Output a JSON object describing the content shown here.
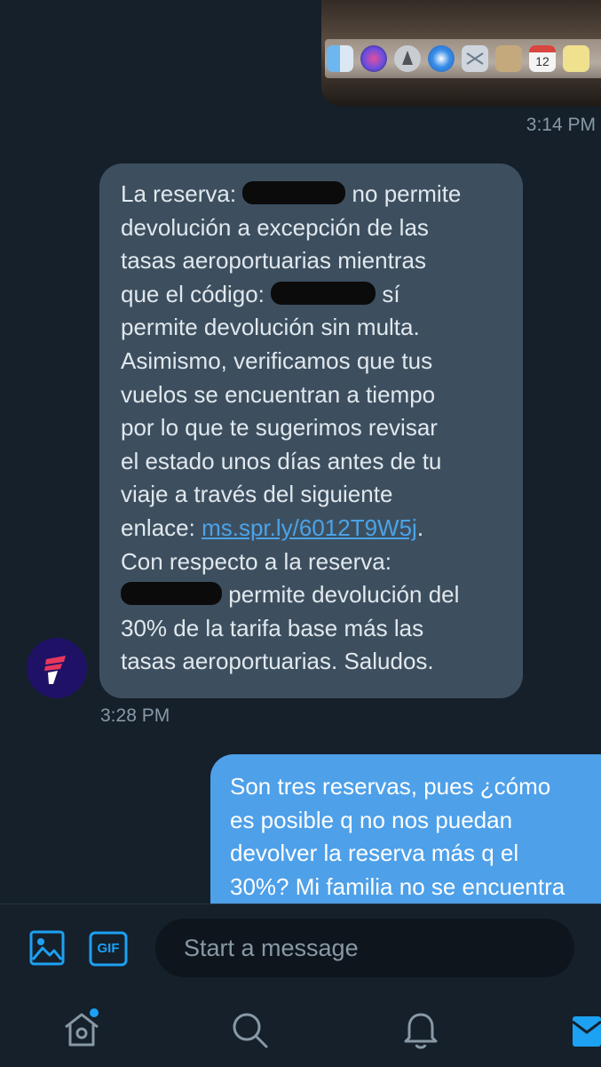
{
  "thread": {
    "image_message": {
      "timestamp": "3:14 PM",
      "calendar_day": "12"
    },
    "incoming_message": {
      "lines": {
        "l1a": "La reserva:",
        "l1b": "no permite",
        "l2": "devolución a excepción de las",
        "l3": "tasas aeroportuarias mientras",
        "l4a": "que el código:",
        "l4b": "sí",
        "l5": "permite devolución sin multa.",
        "l6": "Asimismo, verificamos que tus",
        "l7": "vuelos se encuentran a tiempo",
        "l8": "por lo que te sugerimos revisar",
        "l9": "el estado unos días antes de tu",
        "l10": "viaje a través del siguiente",
        "l11a": "enlace:",
        "l11_link": "ms.spr.ly/6012T9W5j",
        "l11b": ".",
        "l12": "Con respecto a la reserva:",
        "l13b": "permite devolución del",
        "l14": "30% de la tarifa base más las",
        "l15": "tasas aeroportuarias. Saludos."
      },
      "timestamp": "3:28 PM"
    },
    "outgoing_message": {
      "lines": {
        "l1": "Son tres reservas, pues ¿cómo",
        "l2": "es posible q no nos puedan",
        "l3": "devolver la reserva más q el",
        "l4": "30%? Mi familia no se encuentra"
      }
    }
  },
  "composer": {
    "placeholder": "Start a message",
    "gif_label": "GIF"
  },
  "colors": {
    "background": "#15202b",
    "incoming_bubble": "#3d4f5f",
    "outgoing_bubble": "#4ea0e9",
    "accent": "#1da1f2",
    "link": "#4aa3e8"
  },
  "icons": {
    "composer": [
      "image-icon",
      "gif-icon"
    ],
    "tabbar": [
      "home-icon",
      "search-icon",
      "notifications-icon",
      "messages-icon"
    ],
    "avatar": "latam-logo"
  }
}
